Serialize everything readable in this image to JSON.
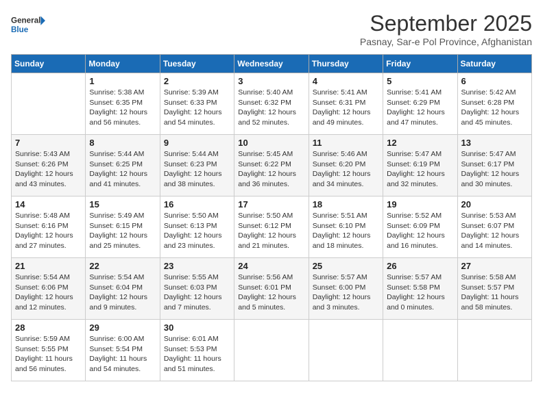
{
  "logo": {
    "line1": "General",
    "line2": "Blue"
  },
  "title": "September 2025",
  "subtitle": "Pasnay, Sar-e Pol Province, Afghanistan",
  "days_of_week": [
    "Sunday",
    "Monday",
    "Tuesday",
    "Wednesday",
    "Thursday",
    "Friday",
    "Saturday"
  ],
  "weeks": [
    [
      {
        "day": "",
        "info": ""
      },
      {
        "day": "1",
        "info": "Sunrise: 5:38 AM\nSunset: 6:35 PM\nDaylight: 12 hours\nand 56 minutes."
      },
      {
        "day": "2",
        "info": "Sunrise: 5:39 AM\nSunset: 6:33 PM\nDaylight: 12 hours\nand 54 minutes."
      },
      {
        "day": "3",
        "info": "Sunrise: 5:40 AM\nSunset: 6:32 PM\nDaylight: 12 hours\nand 52 minutes."
      },
      {
        "day": "4",
        "info": "Sunrise: 5:41 AM\nSunset: 6:31 PM\nDaylight: 12 hours\nand 49 minutes."
      },
      {
        "day": "5",
        "info": "Sunrise: 5:41 AM\nSunset: 6:29 PM\nDaylight: 12 hours\nand 47 minutes."
      },
      {
        "day": "6",
        "info": "Sunrise: 5:42 AM\nSunset: 6:28 PM\nDaylight: 12 hours\nand 45 minutes."
      }
    ],
    [
      {
        "day": "7",
        "info": "Sunrise: 5:43 AM\nSunset: 6:26 PM\nDaylight: 12 hours\nand 43 minutes."
      },
      {
        "day": "8",
        "info": "Sunrise: 5:44 AM\nSunset: 6:25 PM\nDaylight: 12 hours\nand 41 minutes."
      },
      {
        "day": "9",
        "info": "Sunrise: 5:44 AM\nSunset: 6:23 PM\nDaylight: 12 hours\nand 38 minutes."
      },
      {
        "day": "10",
        "info": "Sunrise: 5:45 AM\nSunset: 6:22 PM\nDaylight: 12 hours\nand 36 minutes."
      },
      {
        "day": "11",
        "info": "Sunrise: 5:46 AM\nSunset: 6:20 PM\nDaylight: 12 hours\nand 34 minutes."
      },
      {
        "day": "12",
        "info": "Sunrise: 5:47 AM\nSunset: 6:19 PM\nDaylight: 12 hours\nand 32 minutes."
      },
      {
        "day": "13",
        "info": "Sunrise: 5:47 AM\nSunset: 6:17 PM\nDaylight: 12 hours\nand 30 minutes."
      }
    ],
    [
      {
        "day": "14",
        "info": "Sunrise: 5:48 AM\nSunset: 6:16 PM\nDaylight: 12 hours\nand 27 minutes."
      },
      {
        "day": "15",
        "info": "Sunrise: 5:49 AM\nSunset: 6:15 PM\nDaylight: 12 hours\nand 25 minutes."
      },
      {
        "day": "16",
        "info": "Sunrise: 5:50 AM\nSunset: 6:13 PM\nDaylight: 12 hours\nand 23 minutes."
      },
      {
        "day": "17",
        "info": "Sunrise: 5:50 AM\nSunset: 6:12 PM\nDaylight: 12 hours\nand 21 minutes."
      },
      {
        "day": "18",
        "info": "Sunrise: 5:51 AM\nSunset: 6:10 PM\nDaylight: 12 hours\nand 18 minutes."
      },
      {
        "day": "19",
        "info": "Sunrise: 5:52 AM\nSunset: 6:09 PM\nDaylight: 12 hours\nand 16 minutes."
      },
      {
        "day": "20",
        "info": "Sunrise: 5:53 AM\nSunset: 6:07 PM\nDaylight: 12 hours\nand 14 minutes."
      }
    ],
    [
      {
        "day": "21",
        "info": "Sunrise: 5:54 AM\nSunset: 6:06 PM\nDaylight: 12 hours\nand 12 minutes."
      },
      {
        "day": "22",
        "info": "Sunrise: 5:54 AM\nSunset: 6:04 PM\nDaylight: 12 hours\nand 9 minutes."
      },
      {
        "day": "23",
        "info": "Sunrise: 5:55 AM\nSunset: 6:03 PM\nDaylight: 12 hours\nand 7 minutes."
      },
      {
        "day": "24",
        "info": "Sunrise: 5:56 AM\nSunset: 6:01 PM\nDaylight: 12 hours\nand 5 minutes."
      },
      {
        "day": "25",
        "info": "Sunrise: 5:57 AM\nSunset: 6:00 PM\nDaylight: 12 hours\nand 3 minutes."
      },
      {
        "day": "26",
        "info": "Sunrise: 5:57 AM\nSunset: 5:58 PM\nDaylight: 12 hours\nand 0 minutes."
      },
      {
        "day": "27",
        "info": "Sunrise: 5:58 AM\nSunset: 5:57 PM\nDaylight: 11 hours\nand 58 minutes."
      }
    ],
    [
      {
        "day": "28",
        "info": "Sunrise: 5:59 AM\nSunset: 5:55 PM\nDaylight: 11 hours\nand 56 minutes."
      },
      {
        "day": "29",
        "info": "Sunrise: 6:00 AM\nSunset: 5:54 PM\nDaylight: 11 hours\nand 54 minutes."
      },
      {
        "day": "30",
        "info": "Sunrise: 6:01 AM\nSunset: 5:53 PM\nDaylight: 11 hours\nand 51 minutes."
      },
      {
        "day": "",
        "info": ""
      },
      {
        "day": "",
        "info": ""
      },
      {
        "day": "",
        "info": ""
      },
      {
        "day": "",
        "info": ""
      }
    ]
  ]
}
